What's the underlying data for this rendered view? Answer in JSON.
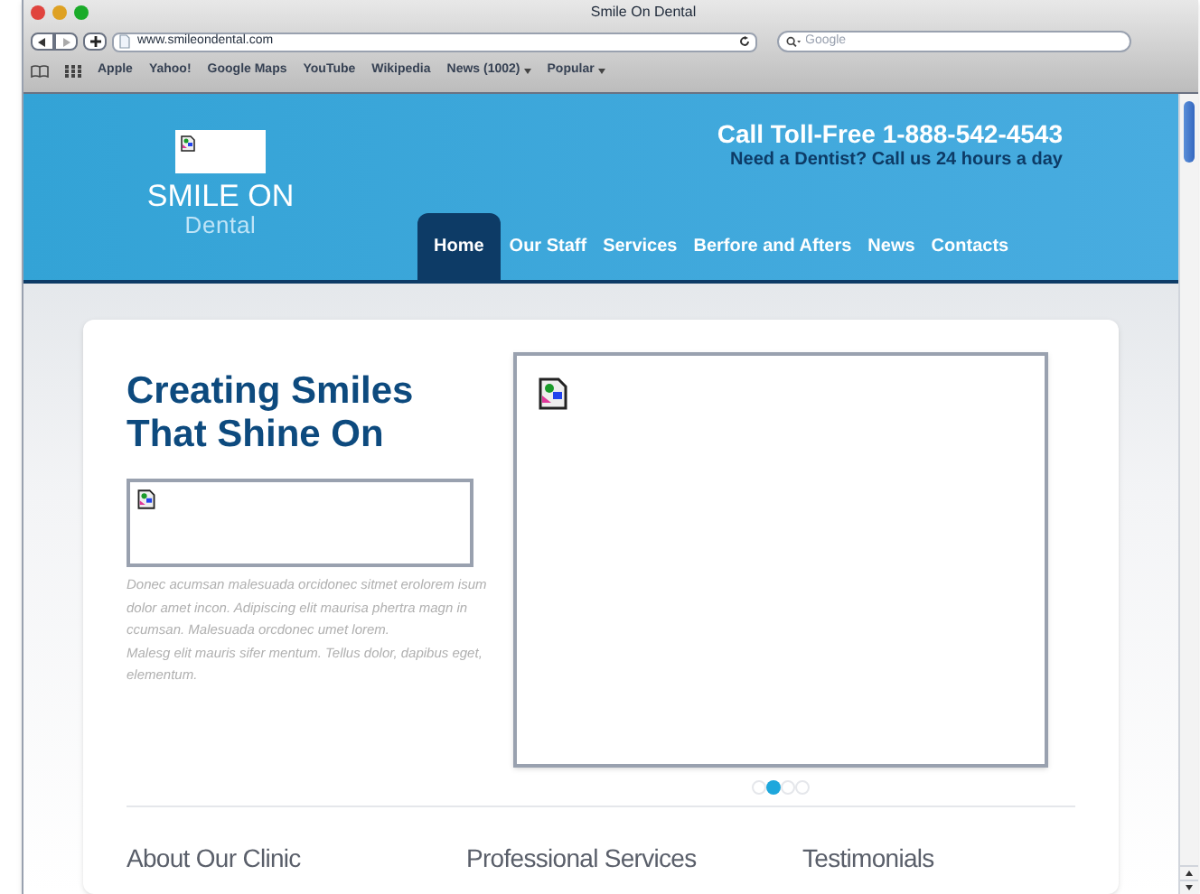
{
  "window": {
    "title": "Smile On Dental"
  },
  "toolbar": {
    "url": "www.smileondental.com",
    "search_placeholder": "Google"
  },
  "bookmarks": [
    {
      "label": "Apple",
      "dropdown": false
    },
    {
      "label": "Yahoo!",
      "dropdown": false
    },
    {
      "label": "Google Maps",
      "dropdown": false
    },
    {
      "label": "YouTube",
      "dropdown": false
    },
    {
      "label": "Wikipedia",
      "dropdown": false
    },
    {
      "label": "News (1002)",
      "dropdown": true
    },
    {
      "label": "Popular",
      "dropdown": true
    }
  ],
  "header": {
    "logo_line1": "SMILE ON",
    "logo_line2": "Dental",
    "phone": "Call Toll-Free 1-888-542-4543",
    "tagline": "Need a Dentist? Call us 24 hours a day"
  },
  "nav": [
    {
      "label": "Home",
      "selected": true
    },
    {
      "label": "Our Staff",
      "selected": false
    },
    {
      "label": "Services",
      "selected": false
    },
    {
      "label": "Berfore and Afters",
      "selected": false
    },
    {
      "label": "News",
      "selected": false
    },
    {
      "label": "Contacts",
      "selected": false
    }
  ],
  "hero": {
    "title": "Creating Smiles That Shine On",
    "paragraphs": [
      "Donec acumsan malesuada orcidonec sitmet erolorem isum dolor amet incon. Adipiscing elit maurisa phertra magn in ccumsan. Malesuada orcdonec umet lorem.",
      "Malesg elit mauris sifer mentum. Tellus dolor, dapibus eget, elementum."
    ]
  },
  "slider_dots": [
    {
      "selected": false
    },
    {
      "selected": true
    },
    {
      "selected": false
    },
    {
      "selected": false
    }
  ],
  "sections": [
    "About Our Clinic",
    "Professional Services",
    "Testimonials"
  ]
}
